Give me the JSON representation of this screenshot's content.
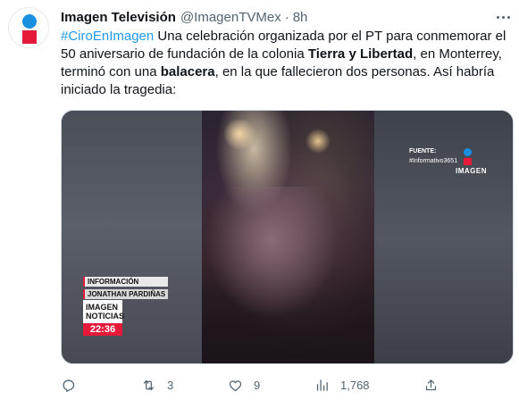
{
  "tweet": {
    "author_name": "Imagen Televisión",
    "author_handle": "@ImagenTVMex",
    "separator": "·",
    "time": "8h",
    "text": {
      "line1_hashtag": "#CiroEnImagen",
      "line1_rest": " Una celebración organizada por el PT para conmemorar el",
      "line2_a": "50 aniversario de fundación de la colonia ",
      "line2_bold": "Tierra y Libertad",
      "line2_b": ", en Monterrey,",
      "line3_a": "terminó con una ",
      "line3_bold": "balacera",
      "line3_b": ", en la que fallecieron dos personas. Así habría",
      "line4": "iniciado la tragedia:"
    },
    "video": {
      "source_label": "FUENTE:",
      "source_ref": "#Informativo3651",
      "watermark": "IMAGEN",
      "tag_info": "INFORMACIÓN",
      "tag_reporter": "JONATHAN PARDIÑAS",
      "brand_line1": "IMAGEN",
      "brand_line2": "NOTICIAS",
      "clock": "22:36"
    },
    "actions": {
      "reply_count": "",
      "retweet_count": "3",
      "like_count": "9",
      "views_count": "1,768"
    }
  },
  "colors": {
    "accent": "#1d9bf0",
    "muted": "#536471",
    "brand_red": "#e51a3a",
    "brand_blue": "#1a8fe0"
  },
  "icons": [
    "more-icon",
    "reply-icon",
    "retweet-icon",
    "like-icon",
    "views-icon",
    "share-icon"
  ]
}
